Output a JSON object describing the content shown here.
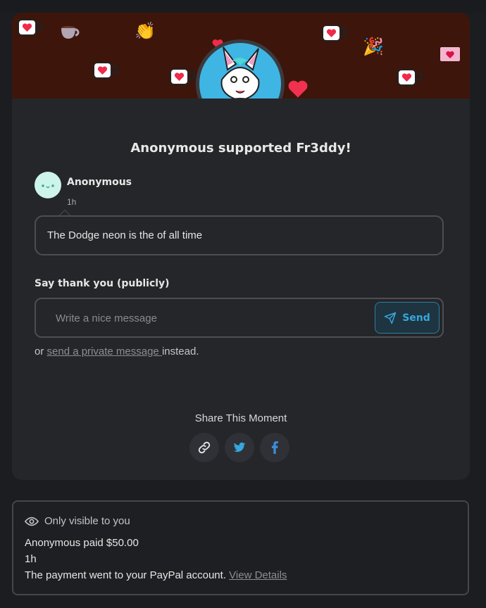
{
  "post": {
    "title": "Anonymous supported Fr3ddy!",
    "supporter_initials_face": "•ˬ•",
    "supporter_name": "Anonymous",
    "supporter_time": "1h",
    "message": "The Dodge neon is the of all time"
  },
  "reply": {
    "label": "Say thank you (publicly)",
    "placeholder": "Write a nice message",
    "send_label": "Send",
    "private_prefix": "or ",
    "private_link": "send a private message ",
    "private_suffix": "instead."
  },
  "share": {
    "title": "Share This Moment",
    "buttons": [
      "link-icon",
      "twitter-icon",
      "facebook-icon"
    ]
  },
  "notice": {
    "visibility": "Only visible to you",
    "paid": "Anonymous paid $50.00",
    "time": "1h",
    "payment_text": "The payment went to your PayPal account. ",
    "details_link": "View Details"
  },
  "colors": {
    "banner": "#3d150b",
    "accent": "#35a7dc",
    "card": "#252629",
    "page": "#1c1d20"
  }
}
